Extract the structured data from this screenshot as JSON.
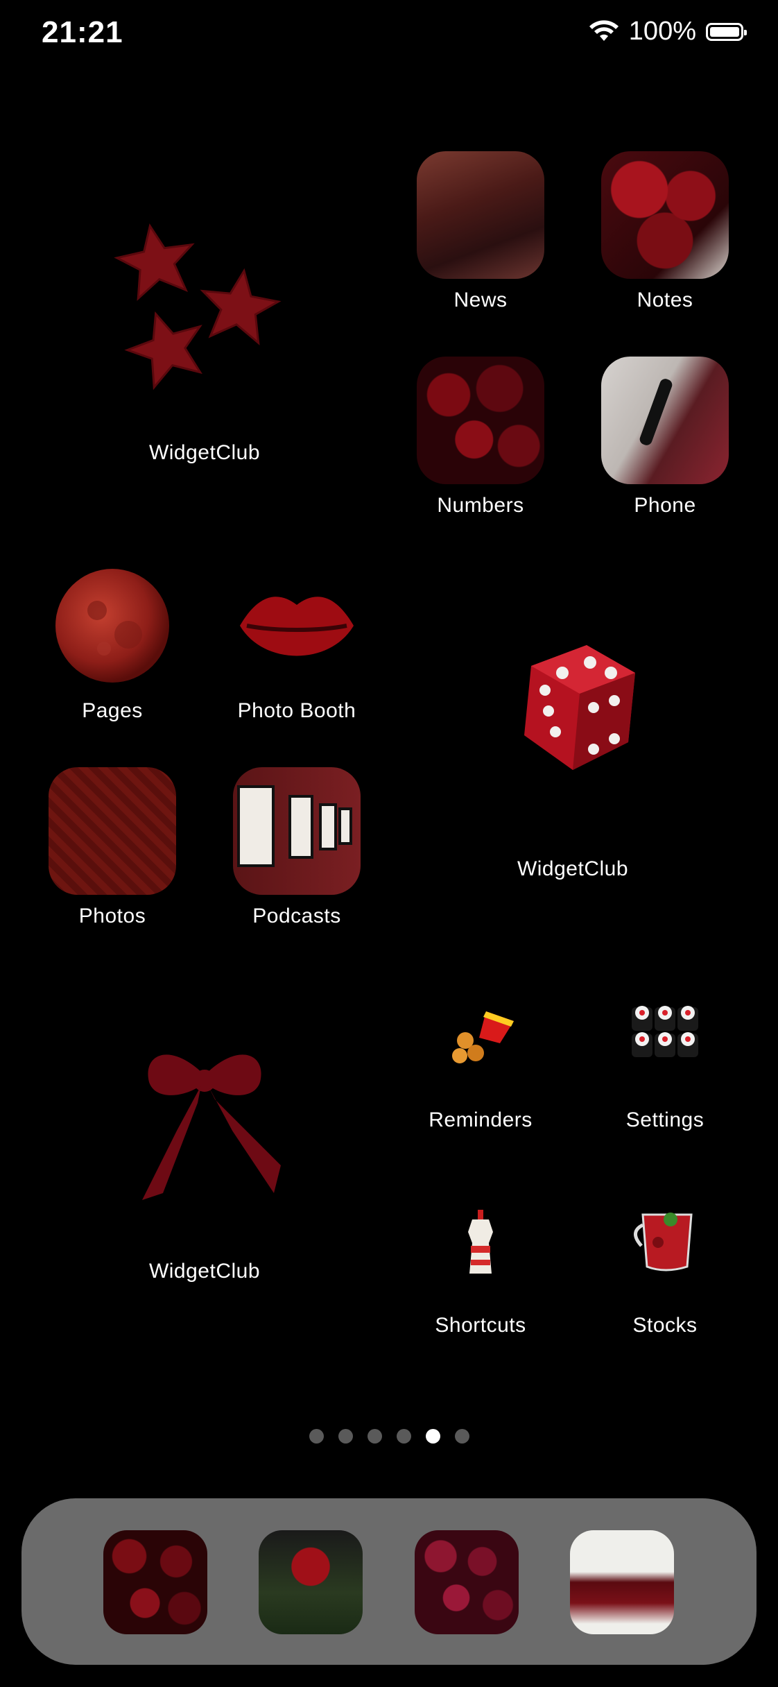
{
  "status_bar": {
    "time": "21:21",
    "battery_percent": "100%",
    "battery_level": 1.0
  },
  "widgets": [
    {
      "label": "WidgetClub",
      "image": "red-stars"
    },
    {
      "label": "WidgetClub",
      "image": "red-dice"
    },
    {
      "label": "WidgetClub",
      "image": "red-bow"
    }
  ],
  "apps": {
    "news": "News",
    "notes": "Notes",
    "numbers": "Numbers",
    "phone": "Phone",
    "pages": "Pages",
    "photo_booth": "Photo Booth",
    "photos": "Photos",
    "podcasts": "Podcasts",
    "reminders": "Reminders",
    "settings": "Settings",
    "shortcuts": "Shortcuts",
    "stocks": "Stocks"
  },
  "page_indicator": {
    "total": 6,
    "current": 5
  },
  "dock": [
    {
      "image": "chocolate-hearts"
    },
    {
      "image": "red-rose"
    },
    {
      "image": "raspberries"
    },
    {
      "image": "spilled-wine"
    }
  ],
  "colors": {
    "background": "#000000",
    "dock": "#6b6b6b",
    "accent": "#8b0a12"
  }
}
